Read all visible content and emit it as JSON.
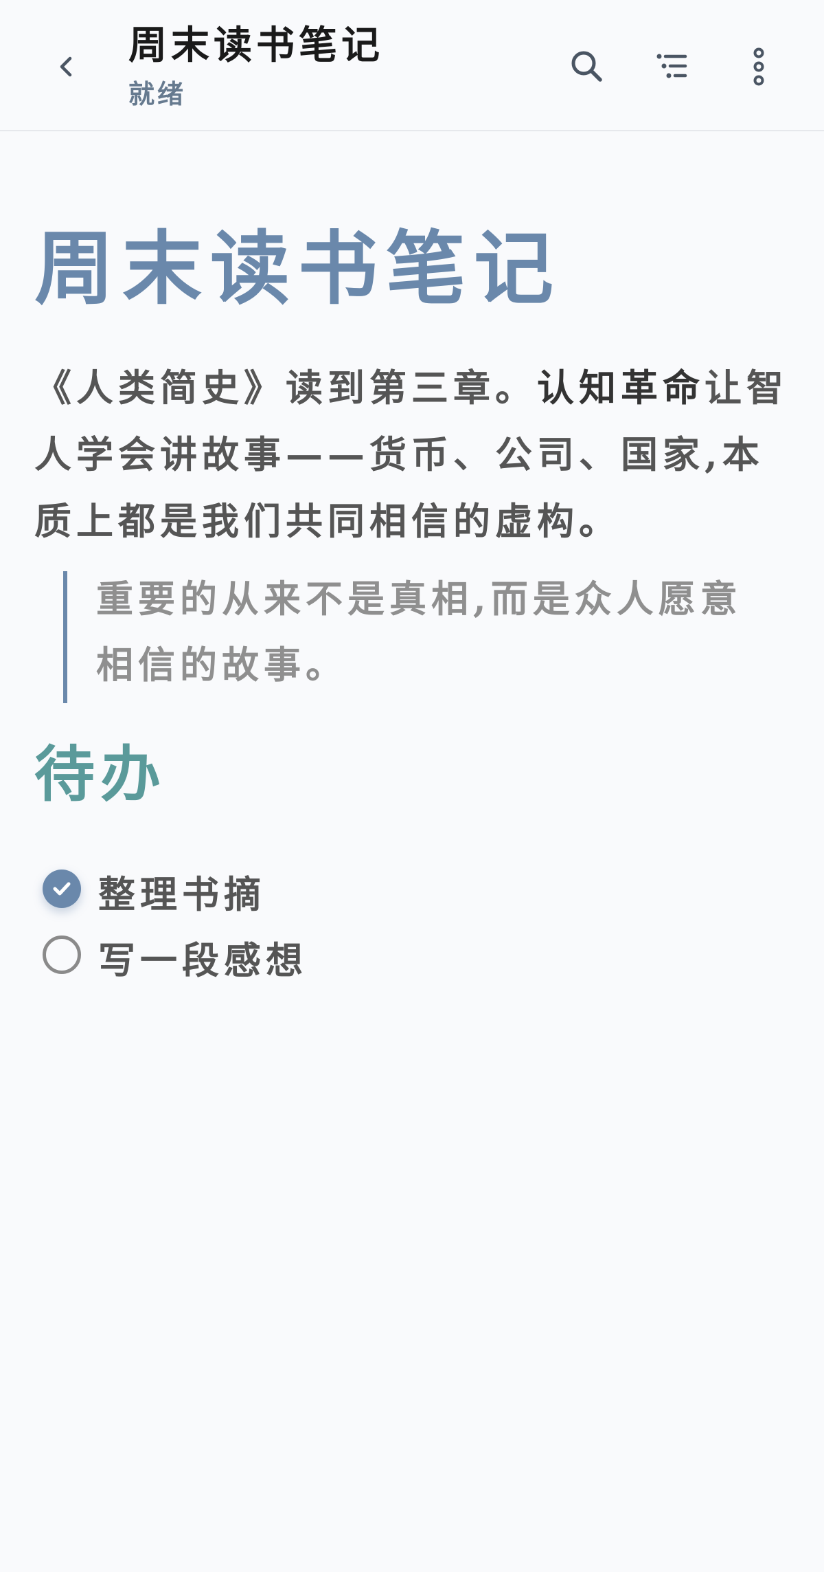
{
  "appbar": {
    "title": "周末读书笔记",
    "status": "就绪",
    "icons": {
      "back": "chevron-left-icon",
      "search": "search-icon",
      "toc": "outline-list-icon",
      "more": "more-vertical-icon"
    }
  },
  "document": {
    "title": "周末读书笔记",
    "paragraph": {
      "before": "《人类简史》读到第三章。",
      "bold": "认知革命",
      "after": "让智人学会讲故事——货币、公司、国家,本质上都是我们共同相信的虚构。"
    },
    "quote": "重要的从来不是真相,而是众人愿意相信的故事。",
    "todo_heading": "待办",
    "todos": [
      {
        "label": "整理书摘",
        "checked": true
      },
      {
        "label": "写一段感想",
        "checked": false
      }
    ]
  },
  "colors": {
    "accent": "#6a88ab",
    "heading2": "#5a9a9a",
    "background": "#f9fafc",
    "text": "#555555"
  }
}
